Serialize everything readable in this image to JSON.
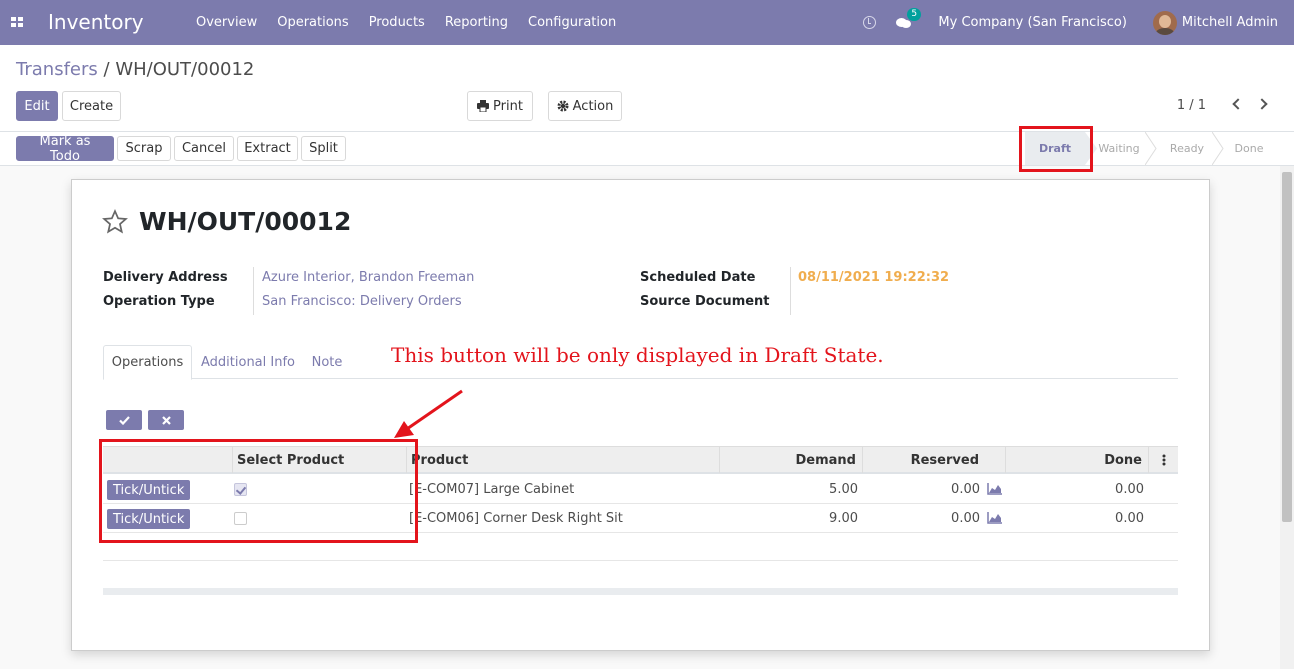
{
  "navbar": {
    "app_name": "Inventory",
    "menu": [
      "Overview",
      "Operations",
      "Products",
      "Reporting",
      "Configuration"
    ],
    "chat_badge": "5",
    "company": "My Company (San Francisco)",
    "user": "Mitchell Admin",
    "icons": [
      "apps-icon",
      "clock-icon",
      "chat-icon",
      "avatar"
    ]
  },
  "breadcrumb": {
    "parent": "Transfers",
    "separator": "/",
    "current": "WH/OUT/00012"
  },
  "toolbar": {
    "edit": "Edit",
    "create": "Create",
    "print": "Print",
    "action": "Action",
    "pager": "1 / 1"
  },
  "statusbar": {
    "buttons": [
      "Mark as Todo",
      "Scrap",
      "Cancel",
      "Extract",
      "Split"
    ],
    "stages": [
      "Draft",
      "Waiting",
      "Ready",
      "Done"
    ],
    "active_stage": "Draft"
  },
  "record": {
    "title": "WH/OUT/00012",
    "fields": {
      "delivery_address_label": "Delivery Address",
      "delivery_address": "Azure Interior, Brandon Freeman",
      "operation_type_label": "Operation Type",
      "operation_type": "San Francisco: Delivery Orders",
      "scheduled_date_label": "Scheduled Date",
      "scheduled_date": "08/11/2021 19:22:32",
      "source_document_label": "Source Document"
    }
  },
  "tabs": [
    "Operations",
    "Additional Info",
    "Note"
  ],
  "annotation": "This button will be only displayed in Draft State.",
  "table": {
    "headers": [
      "",
      "Select Product",
      "Product",
      "Demand",
      "Reserved",
      "Done"
    ],
    "rows": [
      {
        "button": "Tick/Untick",
        "selected": true,
        "product": "[E-COM07] Large Cabinet",
        "demand": "5.00",
        "reserved": "0.00",
        "done": "0.00"
      },
      {
        "button": "Tick/Untick",
        "selected": false,
        "product": "[E-COM06] Corner Desk Right Sit",
        "demand": "9.00",
        "reserved": "0.00",
        "done": "0.00"
      }
    ]
  },
  "colors": {
    "brand": "#7c7bad",
    "highlight": "#e3141c",
    "date": "#f0ad4e"
  }
}
